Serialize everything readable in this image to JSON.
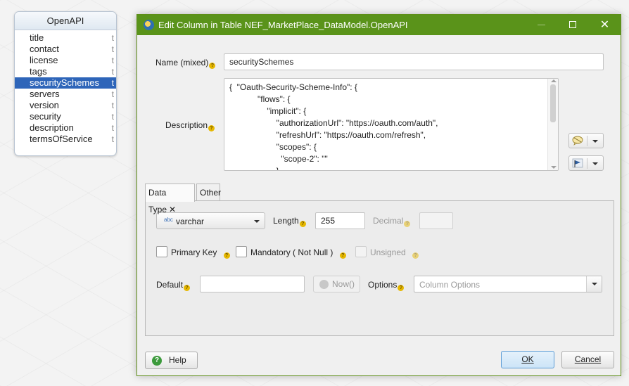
{
  "entity": {
    "title": "OpenAPI",
    "rows": [
      {
        "name": "title",
        "type": "t"
      },
      {
        "name": "contact",
        "type": "t"
      },
      {
        "name": "license",
        "type": "t"
      },
      {
        "name": "tags",
        "type": "t"
      },
      {
        "name": "securitySchemes",
        "type": "t",
        "selected": true
      },
      {
        "name": "servers",
        "type": "t"
      },
      {
        "name": "version",
        "type": "t"
      },
      {
        "name": "security",
        "type": "t"
      },
      {
        "name": "description",
        "type": "t"
      },
      {
        "name": "termsOfService",
        "type": "t"
      }
    ]
  },
  "dialog": {
    "title": "Edit Column in Table NEF_MarketPlace_DataModel.OpenAPI",
    "name_label": "Name (mixed)",
    "name_value": "securitySchemes",
    "description_label": "Description",
    "description_lines": [
      "{  \"Oauth-Security-Scheme-Info\": {",
      "            \"flows\": {",
      "                \"implicit\": {",
      "                    \"authorizationUrl\": \"https://oauth.com/auth\",",
      "                    \"refreshUrl\": \"https://oauth.com/refresh\",",
      "                    \"scopes\": {",
      "                      \"scope-2\": \"\"",
      "                    }"
    ],
    "tabs": [
      {
        "label": "Data Type",
        "close": "✕"
      },
      {
        "label": "Other"
      }
    ],
    "data_type": {
      "type_icon": "abc",
      "type_value": "varchar",
      "length_label": "Length",
      "length_value": "255",
      "decimal_label": "Decimal",
      "decimal_value": "",
      "primary_key_label": "Primary Key",
      "mandatory_label": "Mandatory ( Not Null )",
      "unsigned_label": "Unsigned",
      "default_label": "Default",
      "default_value": "",
      "now_label": "Now()",
      "options_label": "Options",
      "options_placeholder": "Column Options"
    },
    "buttons": {
      "help": "Help",
      "ok": "OK",
      "cancel": "Cancel"
    },
    "colors": {
      "titlebar": "#5a931a",
      "selection": "#2e65b9",
      "ok_border": "#5b9bd5"
    }
  }
}
